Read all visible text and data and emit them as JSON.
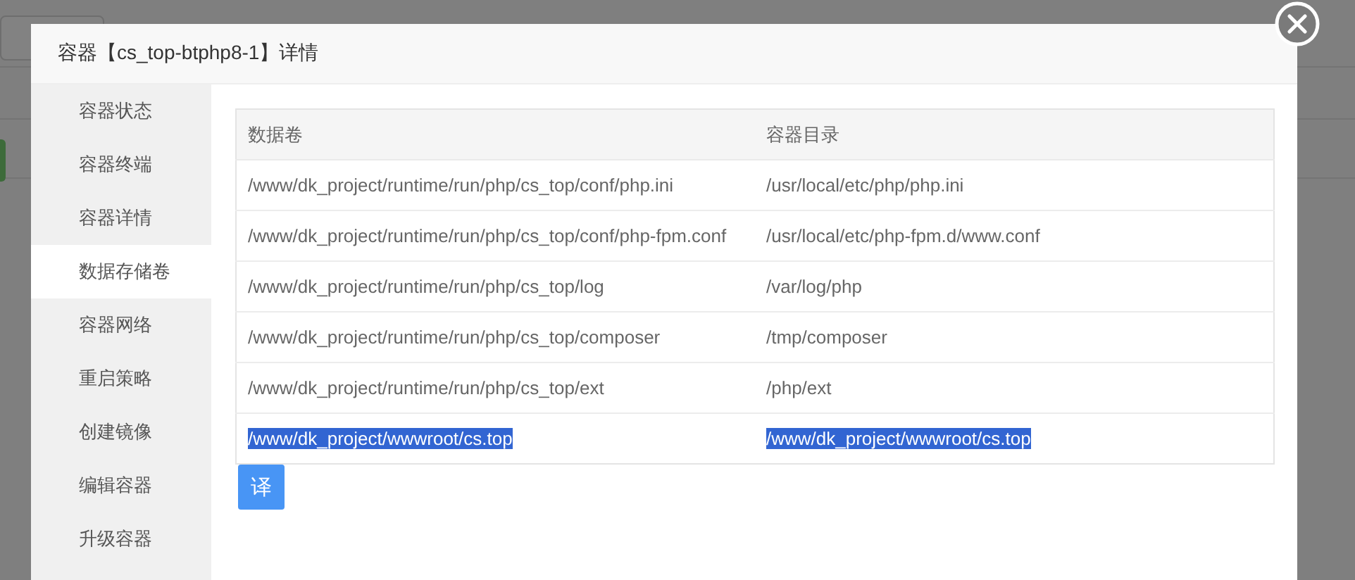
{
  "dialog": {
    "title": "容器【cs_top-btphp8-1】详情"
  },
  "sidebar": {
    "items": [
      {
        "label": "容器状态",
        "selected": false
      },
      {
        "label": "容器终端",
        "selected": false
      },
      {
        "label": "容器详情",
        "selected": false
      },
      {
        "label": "数据存储卷",
        "selected": true
      },
      {
        "label": "容器网络",
        "selected": false
      },
      {
        "label": "重启策略",
        "selected": false
      },
      {
        "label": "创建镜像",
        "selected": false
      },
      {
        "label": "编辑容器",
        "selected": false
      },
      {
        "label": "升级容器",
        "selected": false
      }
    ]
  },
  "table": {
    "columns": [
      "数据卷",
      "容器目录"
    ],
    "rows": [
      {
        "cells": [
          "/www/dk_project/runtime/run/php/cs_top/conf/php.ini",
          "/usr/local/etc/php/php.ini"
        ],
        "text_selected": false
      },
      {
        "cells": [
          "/www/dk_project/runtime/run/php/cs_top/conf/php-fpm.conf",
          "/usr/local/etc/php-fpm.d/www.conf"
        ],
        "text_selected": false
      },
      {
        "cells": [
          "/www/dk_project/runtime/run/php/cs_top/log",
          "/var/log/php"
        ],
        "text_selected": false
      },
      {
        "cells": [
          "/www/dk_project/runtime/run/php/cs_top/composer",
          "/tmp/composer"
        ],
        "text_selected": false
      },
      {
        "cells": [
          "/www/dk_project/runtime/run/php/cs_top/ext",
          "/php/ext"
        ],
        "text_selected": false
      },
      {
        "cells": [
          "/www/dk_project/wwwroot/cs.top",
          "/www/dk_project/wwwroot/cs.top"
        ],
        "text_selected": true
      }
    ]
  },
  "translate_button": {
    "label": "译"
  }
}
